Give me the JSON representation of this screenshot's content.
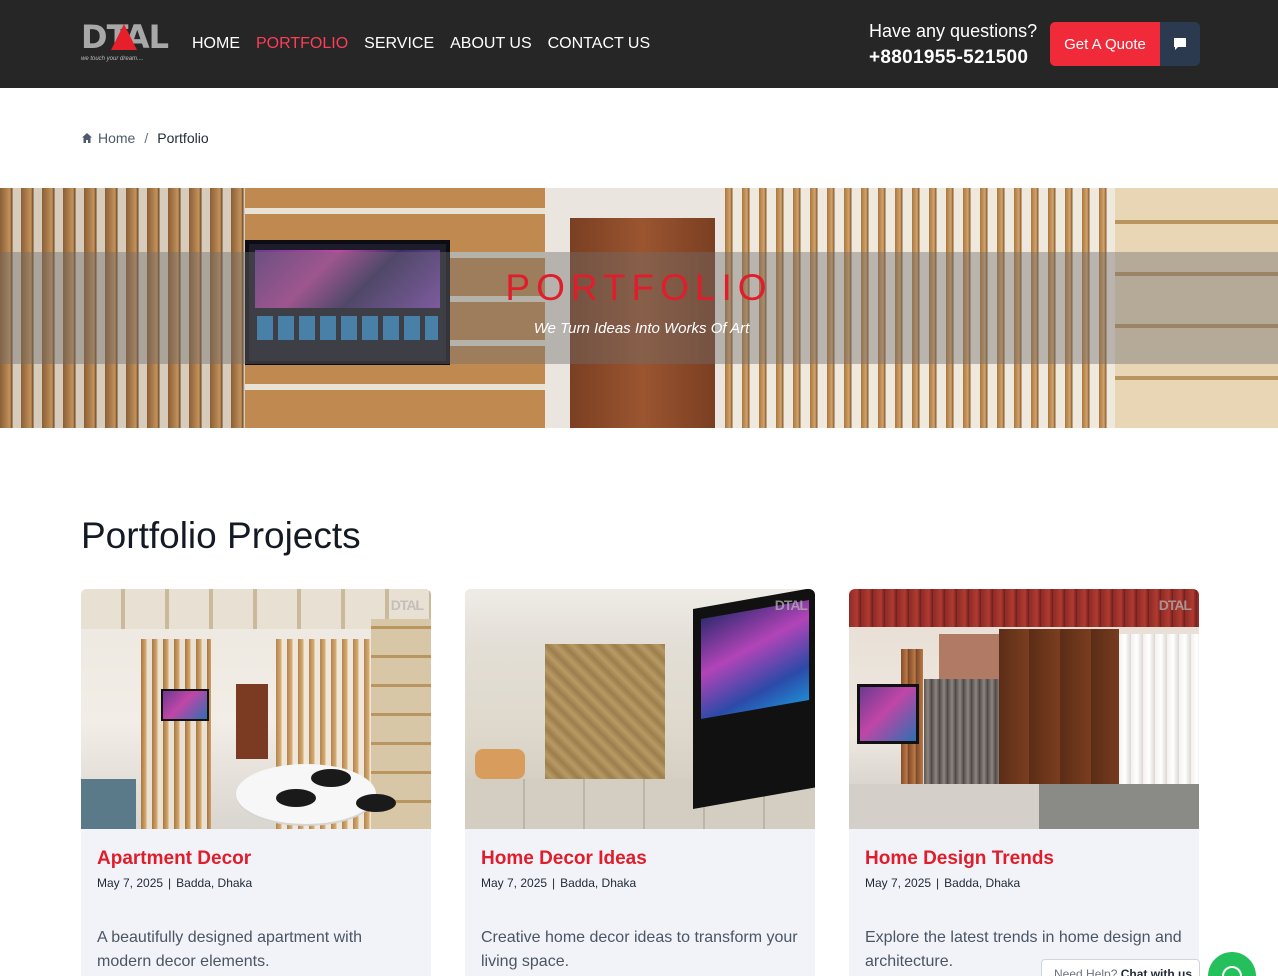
{
  "header": {
    "logo_text": "DTAL",
    "logo_tagline": "we touch your dream....",
    "nav": [
      {
        "label": "HOME",
        "active": false
      },
      {
        "label": "PORTFOLIO",
        "active": true
      },
      {
        "label": "SERVICE",
        "active": false
      },
      {
        "label": "ABOUT US",
        "active": false
      },
      {
        "label": "CONTACT US",
        "active": false
      }
    ],
    "question": "Have any questions?",
    "phone": "+8801955-521500",
    "quote_button": "Get A Quote",
    "chat_icon": "message-icon"
  },
  "breadcrumb": {
    "home_icon": "home-icon",
    "home": "Home",
    "separator": "/",
    "current": "Portfolio"
  },
  "hero": {
    "title": "PORTFOLIO",
    "subtitle": "We Turn Ideas Into Works Of Art"
  },
  "section": {
    "title": "Portfolio Projects"
  },
  "cards": [
    {
      "title": "Apartment Decor",
      "date": "May 7, 2025",
      "location": "Badda, Dhaka",
      "description": "A beautifully designed apartment with modern decor elements.",
      "watermark": "DTAL"
    },
    {
      "title": "Home Decor Ideas",
      "date": "May 7, 2025",
      "location": "Badda, Dhaka",
      "description": "Creative home decor ideas to transform your living space.",
      "watermark": "DTAL"
    },
    {
      "title": "Home Design Trends",
      "date": "May 7, 2025",
      "location": "Badda, Dhaka",
      "description": "Explore the latest trends in home design and architecture.",
      "watermark": "DTAL"
    }
  ],
  "chat_widget": {
    "prefix": "Need Help?",
    "label": "Chat with us",
    "icon": "whatsapp-icon"
  },
  "colors": {
    "header_bg": "#262626",
    "accent_red": "#e01d2b",
    "quote_button": "#f12a3a",
    "chat_button": "#2c3a4f",
    "card_bg": "#f1f3f8",
    "whatsapp": "#24c05b"
  }
}
